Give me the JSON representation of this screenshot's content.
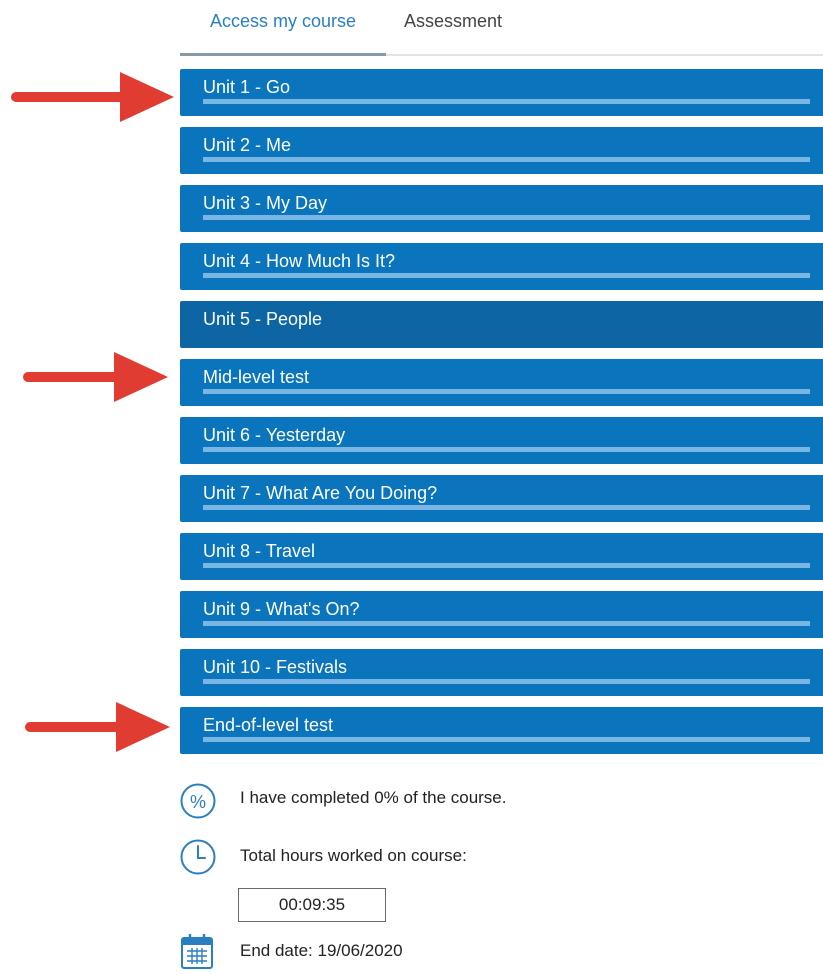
{
  "tabs": {
    "access": "Access my course",
    "assessment": "Assessment"
  },
  "units": [
    {
      "label": "Unit 1 - Go",
      "progress": 0
    },
    {
      "label": "Unit 2 - Me",
      "progress": 0
    },
    {
      "label": "Unit 3 - My Day",
      "progress": 0
    },
    {
      "label": "Unit 4 - How Much Is It?",
      "progress": 0
    },
    {
      "label": "Unit 5 - People",
      "progress": 0
    },
    {
      "label": "Mid-level test",
      "progress": 0
    },
    {
      "label": "Unit 6 - Yesterday",
      "progress": 0
    },
    {
      "label": "Unit 7 - What Are You Doing?",
      "progress": 0
    },
    {
      "label": "Unit 8 - Travel",
      "progress": 0
    },
    {
      "label": "Unit 9 - What's On?",
      "progress": 0
    },
    {
      "label": "Unit 10 - Festivals",
      "progress": 0
    },
    {
      "label": "End-of-level test",
      "progress": 0
    }
  ],
  "info": {
    "completed": "I have completed 0% of the course.",
    "hours_label": "Total hours worked on course:",
    "hours_value": "00:09:35",
    "end_date": "End date: 19/06/2020"
  },
  "colors": {
    "accent": "#0a74bd",
    "arrow": "#e03c31",
    "icon": "#2a7fc0"
  },
  "icons": {
    "percent": "percent-icon",
    "clock": "clock-icon",
    "calendar": "calendar-icon",
    "arrow": "arrow-right-icon"
  }
}
